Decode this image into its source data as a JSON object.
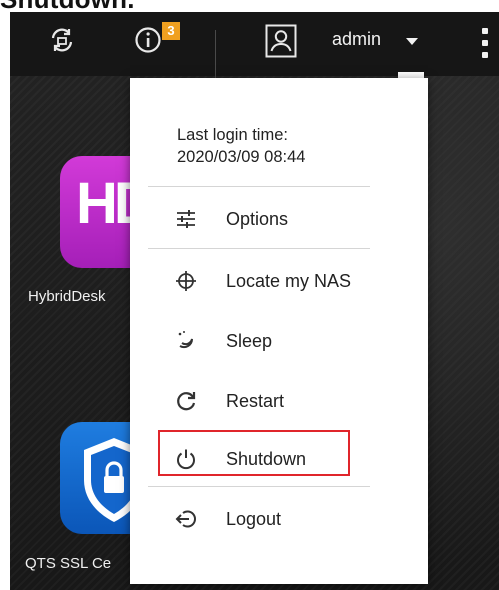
{
  "caption": {
    "text": "Shutdown."
  },
  "topbar": {
    "notification_badge": "3",
    "username": "admin"
  },
  "desktop": {
    "apps": [
      {
        "label": "HybridDesk"
      },
      {
        "label": "QTS SSL Ce"
      }
    ],
    "hybriddesk_logo_text": "HD"
  },
  "menu": {
    "last_login_title": "Last login time:",
    "last_login_time": "2020/03/09 08:44",
    "items": [
      {
        "label": "Options",
        "icon": "sliders-icon"
      },
      {
        "label": "Locate my NAS",
        "icon": "crosshair-icon"
      },
      {
        "label": "Sleep",
        "icon": "moon-icon"
      },
      {
        "label": "Restart",
        "icon": "restart-icon"
      },
      {
        "label": "Shutdown",
        "icon": "power-icon"
      },
      {
        "label": "Logout",
        "icon": "logout-icon"
      }
    ]
  },
  "colors": {
    "highlight": "#e0252b",
    "badge": "#f0a020",
    "hybriddesk_tile": "#c12fd0",
    "ssl_tile": "#1f7de0"
  }
}
